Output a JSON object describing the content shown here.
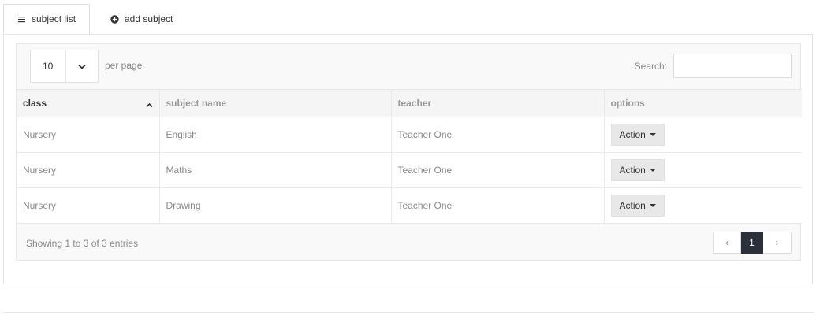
{
  "tabs": [
    {
      "label": "subject list",
      "icon": "list-icon",
      "active": true
    },
    {
      "label": "add subject",
      "icon": "plus-circle-icon",
      "active": false
    }
  ],
  "table_controls": {
    "page_size": "10",
    "per_page_label": "per page",
    "search_label": "Search:",
    "search_value": ""
  },
  "table": {
    "columns": [
      "class",
      "subject name",
      "teacher",
      "options"
    ],
    "sorted_column": "class",
    "rows": [
      {
        "class": "Nursery",
        "subject": "English",
        "teacher": "Teacher One",
        "action": "Action"
      },
      {
        "class": "Nursery",
        "subject": "Maths",
        "teacher": "Teacher One",
        "action": "Action"
      },
      {
        "class": "Nursery",
        "subject": "Drawing",
        "teacher": "Teacher One",
        "action": "Action"
      }
    ]
  },
  "footer": {
    "info": "Showing 1 to 3 of 3 entries",
    "pagination": {
      "prev": "‹",
      "current": "1",
      "next": "›"
    }
  },
  "colors": {
    "active_page": "#2a2f3a"
  }
}
